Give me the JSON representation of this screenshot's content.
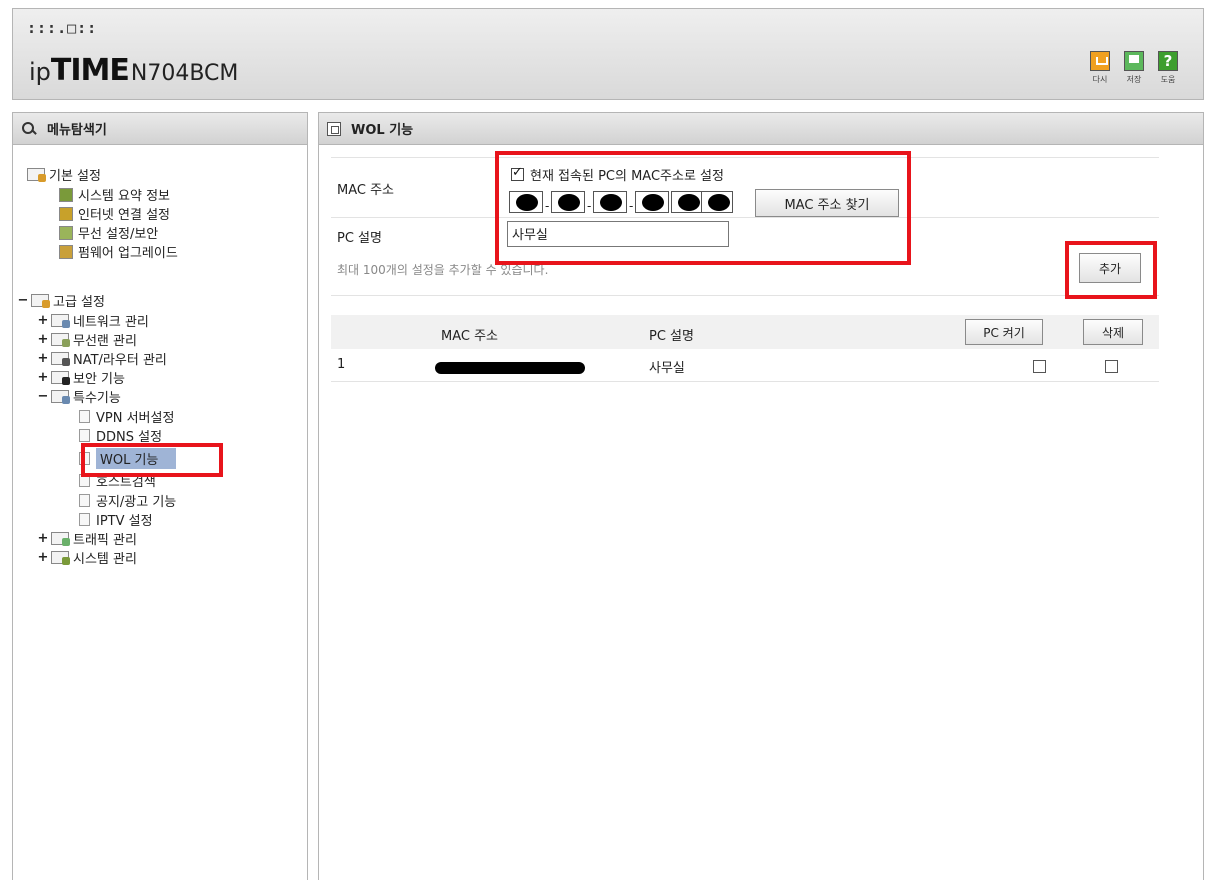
{
  "header": {
    "dots": ":::.□::",
    "brand_ip": "ip",
    "brand_time": "TIME",
    "brand_model": "N704BCM",
    "tools": [
      {
        "label": "다시",
        "icon": "refresh-icon"
      },
      {
        "label": "저장",
        "icon": "save-icon"
      },
      {
        "label": "도움",
        "icon": "help-icon"
      }
    ],
    "help_glyph": "?"
  },
  "sidebar": {
    "title": "메뉴탐색기",
    "basic": {
      "label": "기본 설정",
      "items": [
        "시스템 요약 정보",
        "인터넷 연결 설정",
        "무선 설정/보안",
        "펌웨어 업그레이드"
      ]
    },
    "advanced": {
      "toggle": "−",
      "label": "고급 설정",
      "groups": [
        {
          "toggle": "+",
          "label": "네트워크 관리"
        },
        {
          "toggle": "+",
          "label": "무선랜 관리"
        },
        {
          "toggle": "+",
          "label": "NAT/라우터 관리"
        },
        {
          "toggle": "+",
          "label": "보안 기능"
        },
        {
          "toggle": "−",
          "label": "특수기능"
        }
      ],
      "special_items": [
        "VPN 서버설정",
        "DDNS 설정",
        "WOL 기능",
        "호스트검색",
        "공지/광고 기능",
        "IPTV 설정"
      ],
      "selected_item": "WOL 기능",
      "tail_groups": [
        {
          "toggle": "+",
          "label": "트래픽 관리"
        },
        {
          "toggle": "+",
          "label": "시스템 관리"
        }
      ]
    }
  },
  "main": {
    "title": "WOL 기능",
    "form": {
      "mac_label": "MAC 주소",
      "use_current_pc": "현재 접속된 PC의 MAC주소로 설정",
      "use_current_checked": true,
      "find_mac_button": "MAC 주소 찾기",
      "pc_desc_label": "PC 설명",
      "pc_desc_value": "사무실",
      "hint": "최대 100개의 설정을 추가할 수 있습니다.",
      "add_button": "추가"
    },
    "table": {
      "headers": {
        "mac": "MAC 주소",
        "desc": "PC 설명"
      },
      "wake_button": "PC 켜기",
      "delete_button": "삭제",
      "rows": [
        {
          "index": "1",
          "desc": "사무실"
        }
      ]
    }
  }
}
